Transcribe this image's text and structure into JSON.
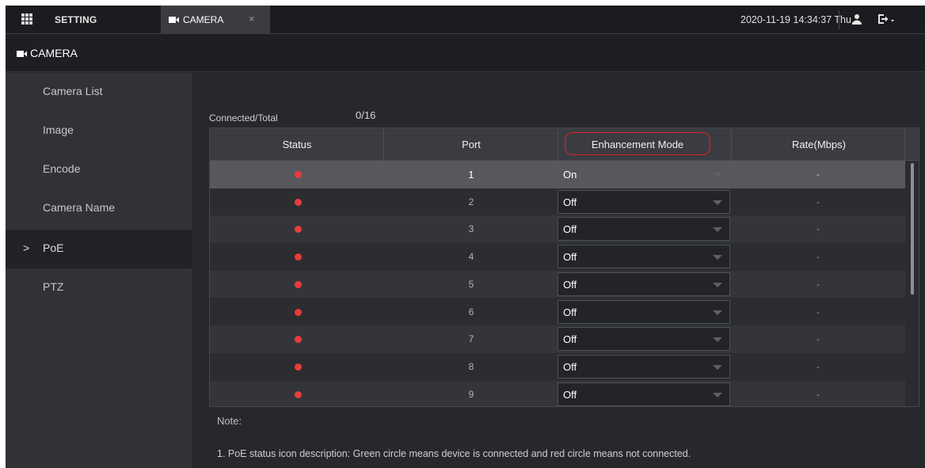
{
  "topbar": {
    "menu_icon": "grid-menu-icon",
    "setting_label": "SETTING",
    "tab_label": "CAMERA",
    "tab_close": "×",
    "datetime": "2020-11-19 14:34:37 Thu",
    "user_icon": "user-icon",
    "logout_icon": "logout-icon"
  },
  "page_header": {
    "title": "CAMERA",
    "icon": "camera-icon"
  },
  "sidebar": {
    "active_index": 4,
    "items": [
      {
        "label": "Camera List"
      },
      {
        "label": "Image"
      },
      {
        "label": "Encode"
      },
      {
        "label": "Camera Name"
      },
      {
        "label": "PoE"
      },
      {
        "label": "PTZ"
      }
    ],
    "chevron": ">"
  },
  "summary": {
    "label": "Connected/Total",
    "value": "0/16"
  },
  "table": {
    "columns": [
      "Status",
      "Port",
      "Enhancement Mode",
      "Rate(Mbps)"
    ],
    "rows": [
      {
        "status": "not-connected",
        "port": "1",
        "mode": "On",
        "rate": "-"
      },
      {
        "status": "not-connected",
        "port": "2",
        "mode": "Off",
        "rate": "-"
      },
      {
        "status": "not-connected",
        "port": "3",
        "mode": "Off",
        "rate": "-"
      },
      {
        "status": "not-connected",
        "port": "4",
        "mode": "Off",
        "rate": "-"
      },
      {
        "status": "not-connected",
        "port": "5",
        "mode": "Off",
        "rate": "-"
      },
      {
        "status": "not-connected",
        "port": "6",
        "mode": "Off",
        "rate": "-"
      },
      {
        "status": "not-connected",
        "port": "7",
        "mode": "Off",
        "rate": "-"
      },
      {
        "status": "not-connected",
        "port": "8",
        "mode": "Off",
        "rate": "-"
      },
      {
        "status": "not-connected",
        "port": "9",
        "mode": "Off",
        "rate": "-"
      }
    ],
    "selected_row": 0
  },
  "note": {
    "title": "Note:",
    "text": "1. PoE status icon description: Green circle means device is connected and red circle means not connected."
  },
  "colors": {
    "status_not_connected": "#ea3b3b",
    "status_connected": "#2fbf4a",
    "highlight_outline": "#d9242a"
  }
}
